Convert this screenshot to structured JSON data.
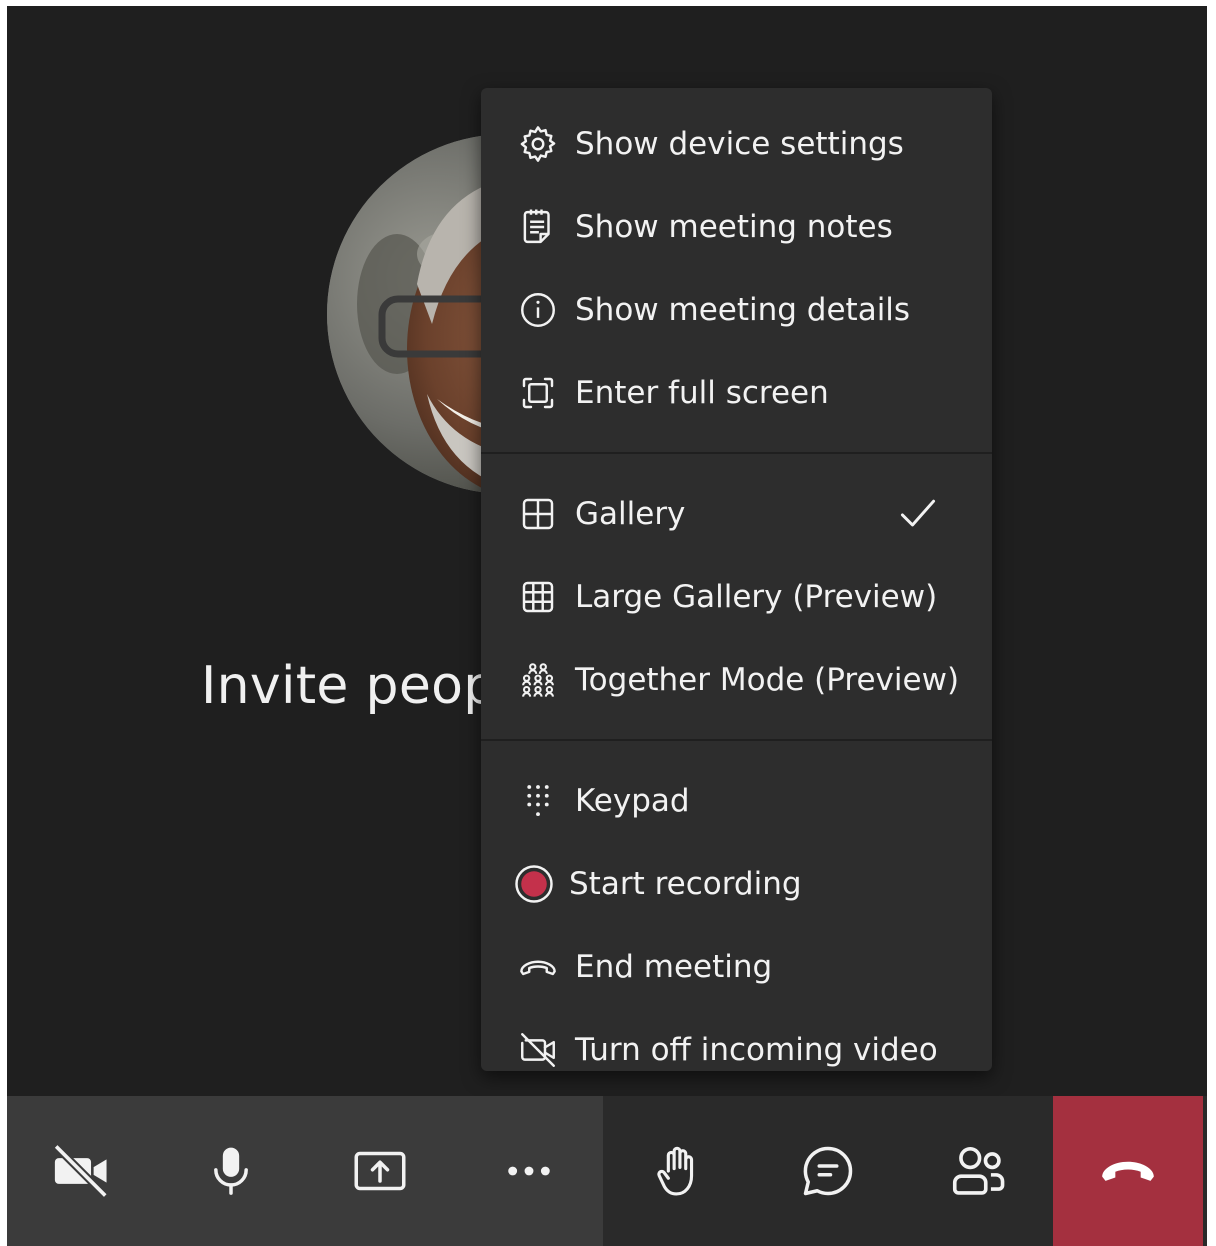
{
  "stage": {
    "invite_text": "Invite peop",
    "background": "#1f1f1f"
  },
  "menu": {
    "group1": [
      {
        "id": "device-settings",
        "label": "Show device settings",
        "icon": "gear-icon"
      },
      {
        "id": "meeting-notes",
        "label": "Show meeting notes",
        "icon": "notes-icon"
      },
      {
        "id": "meeting-details",
        "label": "Show meeting details",
        "icon": "info-icon"
      },
      {
        "id": "full-screen",
        "label": "Enter full screen",
        "icon": "fullscreen-icon"
      }
    ],
    "group2": [
      {
        "id": "gallery",
        "label": "Gallery",
        "icon": "gallery-icon",
        "selected": true
      },
      {
        "id": "large-gallery",
        "label": "Large Gallery (Preview)",
        "icon": "large-gallery-icon"
      },
      {
        "id": "together-mode",
        "label": "Together Mode (Preview)",
        "icon": "together-mode-icon"
      }
    ],
    "group3": [
      {
        "id": "keypad",
        "label": "Keypad",
        "icon": "keypad-icon"
      },
      {
        "id": "start-recording",
        "label": "Start recording",
        "icon": "record-icon"
      },
      {
        "id": "end-meeting",
        "label": "End meeting",
        "icon": "hangup-icon"
      },
      {
        "id": "incoming-video",
        "label": "Turn off incoming video",
        "icon": "video-off-icon"
      }
    ]
  },
  "toolbar": {
    "buttons": [
      {
        "id": "camera",
        "icon": "camera-off-icon"
      },
      {
        "id": "mic",
        "icon": "microphone-icon"
      },
      {
        "id": "share",
        "icon": "share-screen-icon"
      },
      {
        "id": "more",
        "icon": "more-icon"
      },
      {
        "id": "raise-hand",
        "icon": "hand-icon"
      },
      {
        "id": "chat",
        "icon": "chat-icon"
      },
      {
        "id": "participants",
        "icon": "people-icon"
      },
      {
        "id": "hang-up",
        "icon": "hangup-icon"
      }
    ]
  },
  "colors": {
    "menu_bg": "#2d2d2d",
    "toolbar_left_bg": "#3b3b3b",
    "toolbar_right_bg": "#2a2a2a",
    "hangup_bg": "#a4303f",
    "record_red": "#c4314b",
    "text": "#f2f2f2"
  }
}
